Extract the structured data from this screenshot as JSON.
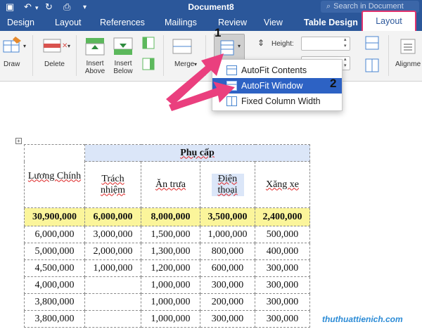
{
  "titlebar": {
    "document_title": "Document8",
    "search_placeholder": "Search in Document"
  },
  "tabs": [
    "Design",
    "Layout",
    "References",
    "Mailings",
    "Review",
    "View",
    "Table Design"
  ],
  "active_tab": "Layout",
  "ribbon": {
    "draw_label": "Draw",
    "delete_label": "Delete",
    "insert_above_label": "Insert Above",
    "insert_below_label": "Insert Below",
    "merge_label": "Merge",
    "height_label": "Height:",
    "alignment_label": "Alignme"
  },
  "callouts": {
    "first": "1",
    "second": "2"
  },
  "autofit_menu": {
    "items": [
      {
        "label": "AutoFit Contents",
        "selected": false
      },
      {
        "label": "AutoFit Window",
        "selected": true
      },
      {
        "label": "Fixed Column Width",
        "selected": false
      }
    ]
  },
  "table": {
    "header": {
      "luong_chinh": "Lương Chính",
      "phu_cap": "Phụ cấp",
      "sub_columns": [
        "Trách nhiệm",
        "Ăn trưa",
        "Điện thoại",
        "Xăng xe"
      ]
    },
    "total_row": [
      "30,900,000",
      "6,000,000",
      "8,000,000",
      "3,500,000",
      "2,400,000"
    ],
    "rows": [
      [
        "6,000,000",
        "3,000,000",
        "1,500,000",
        "1,000,000",
        "500,000"
      ],
      [
        "5,000,000",
        "2,000,000",
        "1,300,000",
        "800,000",
        "400,000"
      ],
      [
        "4,500,000",
        "1,000,000",
        "1,200,000",
        "600,000",
        "300,000"
      ],
      [
        "4,000,000",
        "",
        "1,000,000",
        "300,000",
        "300,000"
      ],
      [
        "3,800,000",
        "",
        "1,000,000",
        "200,000",
        "300,000"
      ],
      [
        "3,800,000",
        "",
        "1,000,000",
        "300,000",
        "300,000"
      ]
    ]
  },
  "watermark": "thuthuattienich.com",
  "colors": {
    "ribbon_blue": "#2b579a",
    "highlight_red": "#e0336e",
    "menu_selected": "#2d62c4",
    "total_row_yellow": "#fbf59b",
    "header_blue": "#dbe6f8"
  }
}
